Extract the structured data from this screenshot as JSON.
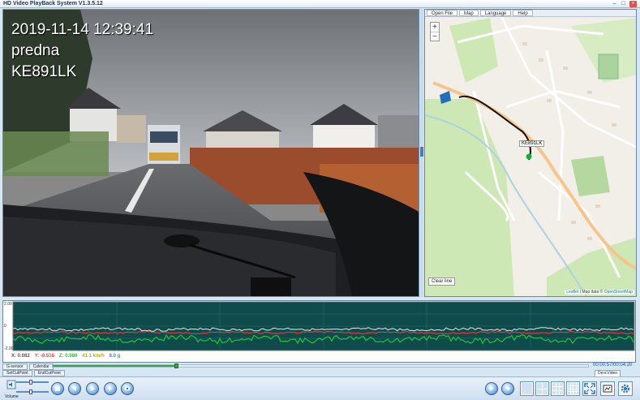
{
  "window": {
    "title": "HD Video PlayBack System V1.3.5.12",
    "controls": {
      "minimize": "–",
      "maximize": "□",
      "close": "×"
    }
  },
  "video": {
    "osd_datetime": "2019-11-14 12:39:41",
    "osd_channel": "predna",
    "osd_plate": "KE891LK"
  },
  "map": {
    "toolbar": [
      "Open File",
      "Map",
      "Language",
      "Help"
    ],
    "zoom_in": "+",
    "zoom_out": "−",
    "vehicle_label": "KE891LK",
    "clear_button": "Clear line",
    "attribution_leaflet": "Leaflet",
    "attribution_text": " | Map data © ",
    "attribution_osm": "OpenStreetMap"
  },
  "graph": {
    "y_top": "2.00",
    "y_mid": "0",
    "y_bottom": "-2.00",
    "readout": {
      "x": "X: 0.082",
      "y": "Y: -0.516",
      "z": "Z: 0.980",
      "speed": "41.1 km/h",
      "g": "8.0 g"
    },
    "colors": {
      "x": "#e8e8e8",
      "y": "#ff3b3b",
      "z": "#22c43a",
      "speed": "#ffd400",
      "g": "#9fd4ff"
    }
  },
  "playback": {
    "tabs_row1": [
      "G-sensor",
      "Calendar"
    ],
    "tabs_row2": [
      "SetCutPoint",
      "EndCutPoint"
    ],
    "progress_fraction": 0.23,
    "timecode": "00:00:57/00:04:20",
    "device_button": "DevcVideo",
    "volume_label": "Volume",
    "volume_fraction": 0.45
  },
  "icons": {
    "stop": "stop-icon",
    "prev": "previous-icon",
    "play": "play-icon",
    "next": "next-icon",
    "snapshot": "snapshot-icon",
    "back": "back-arrow-icon",
    "forward": "forward-arrow-icon",
    "fullscreen": "fullscreen-icon",
    "capture": "capture-icon",
    "settings": "gear-icon"
  }
}
